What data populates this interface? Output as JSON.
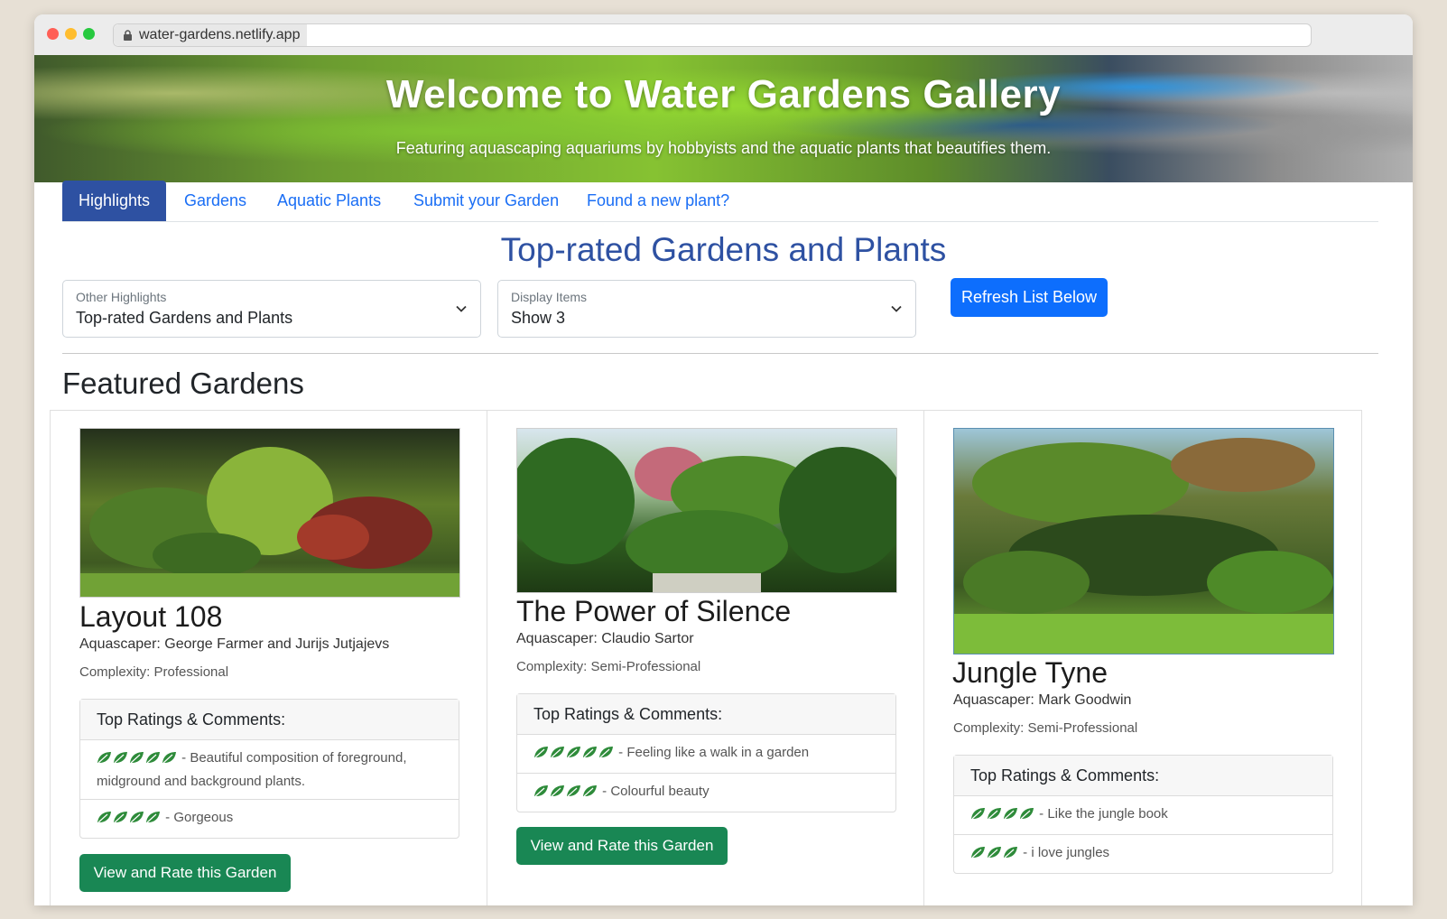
{
  "browser": {
    "url": "water-gardens.netlify.app"
  },
  "hero": {
    "title": "Welcome to Water Gardens Gallery",
    "subtitle": "Featuring aquascaping aquariums by hobbyists and the aquatic plants that beautifies them."
  },
  "nav": {
    "tabs": [
      {
        "label": "Highlights",
        "active": true
      },
      {
        "label": "Gardens",
        "active": false
      },
      {
        "label": "Aquatic Plants",
        "active": false
      },
      {
        "label": "Submit your Garden",
        "active": false
      },
      {
        "label": "Found a new plant?",
        "active": false
      }
    ]
  },
  "page": {
    "heading": "Top-rated Gardens and Plants",
    "filters": {
      "highlight": {
        "label": "Other Highlights",
        "value": "Top-rated Gardens and Plants"
      },
      "display": {
        "label": "Display Items",
        "value": "Show 3"
      },
      "refresh_label": "Refresh List Below"
    },
    "section_title": "Featured Gardens"
  },
  "gardens": [
    {
      "title": "Layout 108",
      "aquascaper": "Aquascaper: George Farmer and Jurijs Jutjajevs",
      "complexity": "Complexity: Professional",
      "ratings_header": "Top Ratings & Comments:",
      "ratings": [
        {
          "leaves": 5,
          "comment": "- Beautiful composition of foreground, midground and background plants."
        },
        {
          "leaves": 4,
          "comment": "- Gorgeous"
        }
      ],
      "button": "View and Rate this Garden"
    },
    {
      "title": "The Power of Silence",
      "aquascaper": "Aquascaper: Claudio Sartor",
      "complexity": "Complexity: Semi-Professional",
      "ratings_header": "Top Ratings & Comments:",
      "ratings": [
        {
          "leaves": 5,
          "comment": "- Feeling like a walk in a garden"
        },
        {
          "leaves": 4,
          "comment": "- Colourful beauty"
        }
      ],
      "button": "View and Rate this Garden"
    },
    {
      "title": "Jungle Tyne",
      "aquascaper": "Aquascaper: Mark Goodwin",
      "complexity": "Complexity: Semi-Professional",
      "ratings_header": "Top Ratings & Comments:",
      "ratings": [
        {
          "leaves": 4,
          "comment": "- Like the jungle book"
        },
        {
          "leaves": 3,
          "comment": "- i love jungles"
        }
      ]
    }
  ],
  "colors": {
    "brand_blue": "#2e51a2",
    "link_blue": "#1a6ef5",
    "primary_button": "#0d6efd",
    "success_button": "#198754",
    "leaf_green": "#2e8b3a"
  }
}
